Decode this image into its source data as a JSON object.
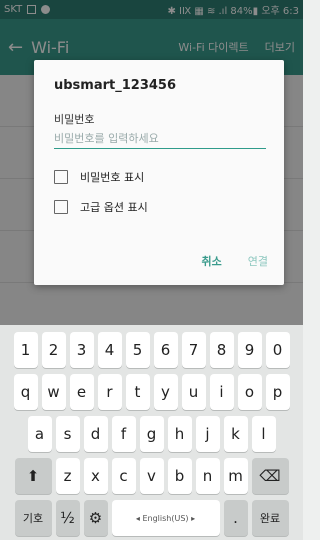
{
  "statusbar": {
    "carrier": "SKT",
    "right": "✱ ⅠⅨ ▦ ≋ .ıl 84%▮ 오후 6:3"
  },
  "appbar": {
    "back": "←",
    "title": "Wi-Fi",
    "action1": "Wi-Fi 다이렉트",
    "action2": "더보기"
  },
  "dialog": {
    "title": "ubsmart_123456",
    "password_label": "비밀번호",
    "password_placeholder": "비밀번호를 입력하세요",
    "show_password_label": "비밀번호 표시",
    "advanced_label": "고급 옵션 표시",
    "cancel_label": "취소",
    "connect_label": "연결"
  },
  "keyboard": {
    "row1": [
      "1",
      "2",
      "3",
      "4",
      "5",
      "6",
      "7",
      "8",
      "9",
      "0"
    ],
    "row2": [
      "q",
      "w",
      "e",
      "r",
      "t",
      "y",
      "u",
      "i",
      "o",
      "p"
    ],
    "row3": [
      "a",
      "s",
      "d",
      "f",
      "g",
      "h",
      "j",
      "k",
      "l"
    ],
    "row4": [
      "z",
      "x",
      "c",
      "v",
      "b",
      "n",
      "m"
    ],
    "shift": "⬆",
    "backspace": "⌫",
    "symbols": "기호",
    "fraction": "½",
    "settings": "⚙",
    "space": "◂  English(US)  ▸",
    "period": ".",
    "done": "완료"
  }
}
